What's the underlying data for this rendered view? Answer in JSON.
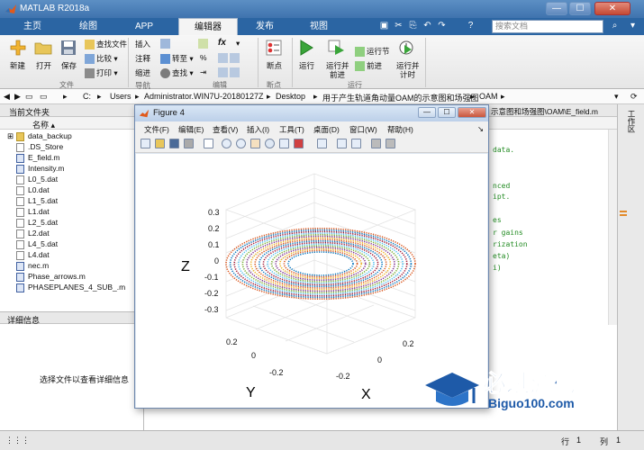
{
  "window": {
    "title": "MATLAB R2018a",
    "min": "—",
    "max": "☐",
    "close": "✕"
  },
  "tabs": [
    {
      "label": "主页",
      "active": false
    },
    {
      "label": "绘图",
      "active": false
    },
    {
      "label": "APP",
      "active": false
    },
    {
      "label": "编辑器",
      "active": true
    },
    {
      "label": "发布",
      "active": false
    },
    {
      "label": "视图",
      "active": false
    }
  ],
  "search": {
    "placeholder": "搜索文档"
  },
  "ribbon": {
    "new": "新建",
    "open": "打开",
    "save": "保存",
    "find_files": "查找文件",
    "compare": "比较",
    "print": "打印",
    "group_file": "文件",
    "insert": "插入",
    "comment": "注释",
    "indent": "缩进",
    "goto": "转至",
    "find": "查找",
    "group_nav": "导航",
    "group_edit": "编辑",
    "breakpoints": "断点",
    "group_break": "断点",
    "run": "运行",
    "run_advance_1": "运行并",
    "run_advance_2": "前进",
    "run_section": "运行节",
    "advance": "前进",
    "run_time_1": "运行并",
    "run_time_2": "计时",
    "group_run": "运行",
    "fx": "fx"
  },
  "address": {
    "parts": [
      "C:",
      "Users",
      "Administrator.WIN7U-20180127Z",
      "Desktop",
      "用于产生轨道角动量OAM的示意图和场强图",
      "OAM"
    ]
  },
  "current_folder": {
    "title": "当前文件夹",
    "column": "名称",
    "files": [
      {
        "name": "data_backup",
        "type": "folder"
      },
      {
        "name": ".DS_Store",
        "type": "file"
      },
      {
        "name": "E_field.m",
        "type": "m"
      },
      {
        "name": "Intensity.m",
        "type": "m"
      },
      {
        "name": "L0_5.dat",
        "type": "file"
      },
      {
        "name": "L0.dat",
        "type": "file"
      },
      {
        "name": "L1_5.dat",
        "type": "file"
      },
      {
        "name": "L1.dat",
        "type": "file"
      },
      {
        "name": "L2_5.dat",
        "type": "file"
      },
      {
        "name": "L2.dat",
        "type": "file"
      },
      {
        "name": "L4_5.dat",
        "type": "file"
      },
      {
        "name": "L4.dat",
        "type": "file"
      },
      {
        "name": "nec.m",
        "type": "m"
      },
      {
        "name": "Phase_arrows.m",
        "type": "m"
      },
      {
        "name": "PHASEPLANES_4_SUB_.m",
        "type": "m"
      }
    ]
  },
  "detail": {
    "title": "详细信息",
    "hint": "选择文件以查看详细信息"
  },
  "editor": {
    "path": "示意图和场强图\\OAM\\E_field.m",
    "lines": [
      {
        "text": "data.",
        "color": "#228b22"
      },
      {
        "text": "nced",
        "color": "#228b22"
      },
      {
        "text": "ipt.",
        "color": "#228b22"
      },
      {
        "text": "es",
        "color": "#228b22"
      },
      {
        "text": "r gains",
        "color": "#228b22"
      },
      {
        "text": "rization",
        "color": "#228b22"
      },
      {
        "text": "eta)",
        "color": "#228b22"
      },
      {
        "text": "i)",
        "color": "#228b22"
      }
    ]
  },
  "right_strip": {
    "label": "工作区"
  },
  "status": {
    "row_label": "行",
    "row": "1",
    "col_label": "列",
    "col": "1"
  },
  "figure": {
    "title": "Figure 4",
    "menu": [
      "文件(F)",
      "编辑(E)",
      "查看(V)",
      "插入(I)",
      "工具(T)",
      "桌面(D)",
      "窗口(W)",
      "帮助(H)"
    ],
    "axes": {
      "z_label": "Z",
      "y_label": "Y",
      "x_label": "X",
      "z_ticks": [
        "0.3",
        "0.2",
        "0.1",
        "0",
        "-0.1",
        "-0.2",
        "-0.3"
      ],
      "y_ticks": [
        "0.2",
        "0",
        "-0.2"
      ],
      "x_ticks": [
        "-0.2",
        "0",
        "0.2"
      ]
    },
    "ring_colors": [
      "#0072bd",
      "#d95319",
      "#edb120",
      "#7e2f8e",
      "#77ac30",
      "#4dbeee",
      "#a2142f"
    ]
  },
  "watermark": {
    "brand": "必过源码",
    "url": "Biguo100.com"
  }
}
